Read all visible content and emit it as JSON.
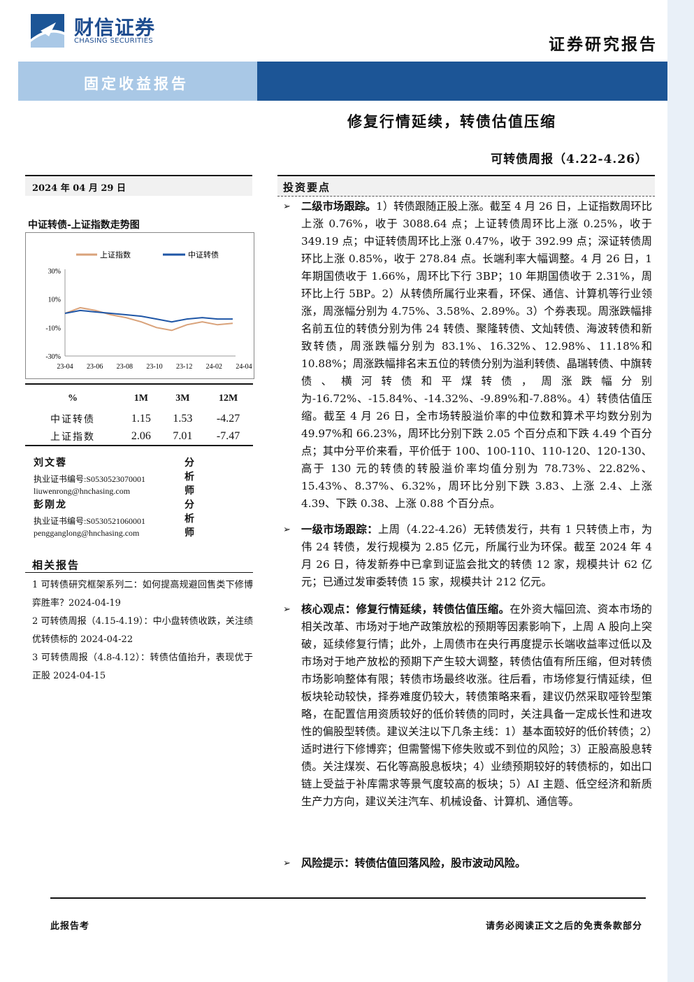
{
  "colors": {
    "brand_blue": "#1c5596",
    "band_light": "#a9c8e6",
    "index_shanghai": "#d9a27a",
    "index_cb": "#1f56a6"
  },
  "header": {
    "logo_cn": "财信证券",
    "logo_en": "CHASING SECURITIES",
    "report_type": "证券研究报告",
    "band_label": "固定收益报告",
    "main_title": "修复行情延续，转债估值压缩",
    "sub_title": "可转债周报（4.22-4.26）"
  },
  "left": {
    "date": "2024 年 04 月 29 日",
    "chart_title": "中证转债-上证指数走势图",
    "table": {
      "headers": [
        "%",
        "1M",
        "3M",
        "12M"
      ],
      "rows": [
        {
          "name": "中证转债",
          "m1": "1.15",
          "m3": "1.53",
          "m12": "-4.27"
        },
        {
          "name": "上证指数",
          "m1": "2.06",
          "m3": "7.01",
          "m12": "-7.47"
        }
      ]
    },
    "analysts": [
      {
        "name": "刘文蓉",
        "role": "分析师",
        "cert": "执业证书编号:S0530523070001",
        "email": "liuwenrong@hnchasing.com"
      },
      {
        "name": "彭刚龙",
        "role": "分析师",
        "cert": "执业证书编号:S0530521060001",
        "email": "pengganglong@hnchasing.com"
      }
    ],
    "related_title": "相关报告",
    "related": [
      "1 可转债研究框架系列二：如何提高规避回售类下修博弈胜率？2024-04-19",
      "2 可转债周报（4.15-4.19）：中小盘转债收跌，关注绩优转债标的 2024-04-22",
      "3 可转债周报（4.8-4.12）：转债估值抬升，表现优于正股 2024-04-15"
    ]
  },
  "chart_data": {
    "type": "line",
    "title": "",
    "x": [
      "23-04",
      "23-06",
      "23-08",
      "23-10",
      "23-12",
      "24-02",
      "24-04"
    ],
    "yticks": [
      "30%",
      "10%",
      "-10%",
      "-30%"
    ],
    "ylim": [
      -30,
      30
    ],
    "series": [
      {
        "name": "上证指数",
        "values": [
          0,
          4,
          2,
          -1,
          -3,
          -6,
          -10,
          -12,
          -8,
          -6,
          -8,
          -7
        ],
        "color": "#d9a27a"
      },
      {
        "name": "中证转债",
        "values": [
          0,
          2,
          1,
          0,
          -1,
          -2,
          -4,
          -6,
          -4,
          -3,
          -4,
          -4
        ],
        "color": "#1f56a6"
      }
    ],
    "legend": "top",
    "grid": false
  },
  "right": {
    "summary_title": "投资要点",
    "bullets": [
      {
        "lead": "二级市场跟踪。",
        "text": "1）转债跟随正股上涨。截至 4 月 26 日，上证指数周环比上涨 0.76%，收于 3088.64 点；上证转债周环比上涨 0.25%，收于 349.19 点；中证转债周环比上涨 0.47%，收于 392.99 点；深证转债周环比上涨 0.85%，收于 278.84 点。长端利率大幅调整。4 月 26 日，1 年期国债收于 1.66%，周环比下行 3BP；10 年期国债收于 2.31%，周环比上行 5BP。2）从转债所属行业来看，环保、通信、计算机等行业领涨，周涨幅分别为 4.75%、3.58%、2.89%。3）个券表现。周涨跌幅排名前五位的转债分别为伟 24 转债、聚隆转债、文灿转债、海波转债和新致转债，周涨跌幅分别为 83.1%、16.32%、12.98%、11.18%和 10.88%；周涨跌幅排名末五位的转债分别为溢利转债、晶瑞转债、中旗转债、横河转债和平煤转债，周涨跌幅分别为-16.72%、-15.84%、-14.32%、-9.89%和-7.88%。4）转债估值压缩。截至 4 月 26 日，全市场转股溢价率的中位数和算术平均数分别为 49.97%和 66.23%，周环比分别下跌 2.05 个百分点和下跌 4.49 个百分点；其中分平价来看，平价低于 100、100-110、110-120、120-130、高于 130 元的转债的转股溢价率均值分别为 78.73%、22.82%、15.43%、8.37%、6.32%，周环比分别下跌 3.83、上涨 2.4、上涨 4.39、下跌 0.38、上涨 0.88 个百分点。"
      },
      {
        "lead": "一级市场跟踪：",
        "text": "上周（4.22-4.26）无转债发行，共有 1 只转债上市，为伟 24 转债，发行规模为 2.85 亿元，所属行业为环保。截至 2024 年 4 月 26 日，待发新券中已拿到证监会批文的转债 12 家，规模共计 62 亿元；已通过发审委转债 15 家，规模共计 212 亿元。"
      },
      {
        "lead": "核心观点：修复行情延续，转债估值压缩。",
        "text": "在外资大幅回流、资本市场的相关改革、市场对于地产政策放松的预期等因素影响下，上周 A 股向上突破，延续修复行情；此外，上周债市在央行再度提示长端收益率过低以及市场对于地产放松的预期下产生较大调整，转债估值有所压缩，但对转债市场影响整体有限；转债市场最终收涨。往后看，市场修复行情延续，但板块轮动较快，择券难度仍较大，转债策略来看，建议仍然采取哑铃型策略，在配置信用资质较好的低价转债的同时，关注具备一定成长性和进攻性的偏股型转债。建议关注以下几条主线：1）基本面较好的低价转债；2）适时进行下修博弈；但需警惕下修失败或不到位的风险；3）正股高股息转债。关注煤炭、石化等高股息板块；4）业绩预期较好的转债标的，如出口链上受益于补库需求等景气度较高的板块；5）AI 主题、低空经济和新质生产力方向，建议关注汽车、机械设备、计算机、通信等。"
      },
      {
        "lead": "风险提示：",
        "text": "转债估值回落风险，股市波动风险。"
      }
    ]
  },
  "footer": {
    "left": "此报告考",
    "right": "请务必阅读正文之后的免责条款部分"
  }
}
